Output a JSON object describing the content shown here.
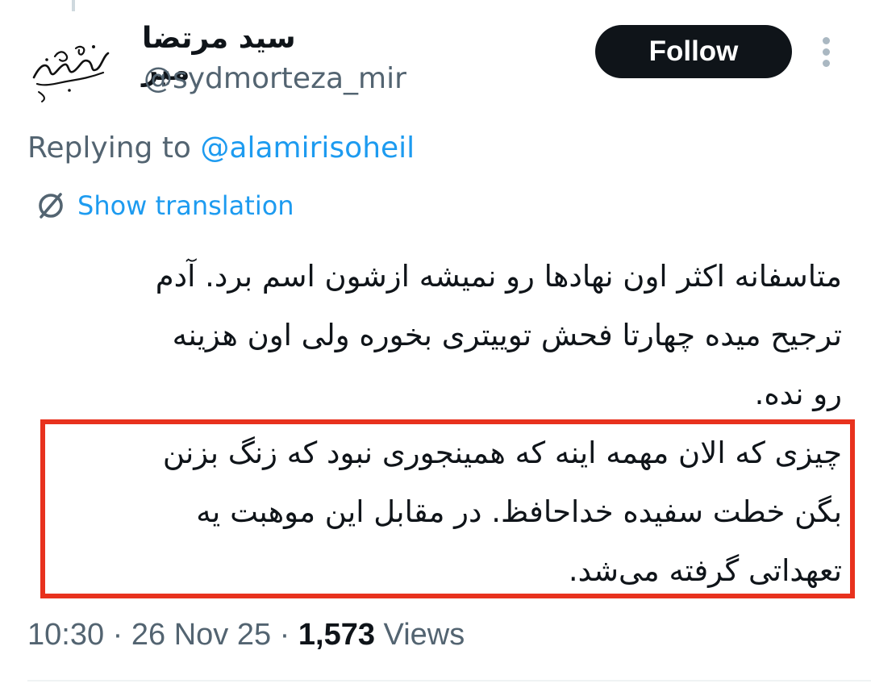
{
  "tweet": {
    "author": {
      "display_name": "سید مرتضا میر",
      "handle": "@sydmorteza_mir"
    },
    "follow_label": "Follow",
    "more_icon": "more-vertical-icon",
    "replying_prefix": "Replying to",
    "replying_to": "@alamirisoheil",
    "translation_icon": "globe-icon",
    "translation_label": "Show translation",
    "text_lines_para1": [
      "متاسفانه اکثر اون نهادها رو نمیشه ازشون اسم برد. آدم",
      "ترجیح میده چهارتا فحش توییتری بخوره ولی اون هزینه",
      "رو نده."
    ],
    "text_lines_para2": [
      "چیزی که الان مهمه اینه که همینجوری نبود که زنگ بزنن",
      "بگن خطت سفیده خداحافظ. در مقابل این موهبت یه",
      "تعهداتی گرفته می‌شد."
    ],
    "time": "10:30",
    "date": "26 Nov 25",
    "separator": "·",
    "views_count": "1,573",
    "views_label": "Views"
  },
  "colors": {
    "text": "#0f1419",
    "secondary": "#536471",
    "link": "#1d9bf0",
    "follow_bg": "#0f1419",
    "highlight": "#e8321e"
  }
}
